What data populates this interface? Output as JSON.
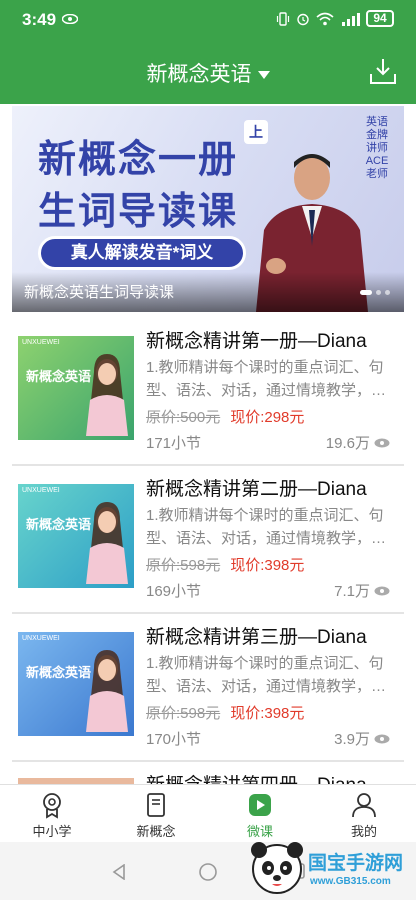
{
  "status_bar": {
    "time": "3:49",
    "battery": "94"
  },
  "header": {
    "title": "新概念英语"
  },
  "banner": {
    "headline_line1": "新概念一册",
    "headline_line2": "生词导读课",
    "badge": "上",
    "tag": "真人解读发音*词义",
    "side_text": "英语金牌讲师ACE老师",
    "caption": "新概念英语生词导读课"
  },
  "courses": [
    {
      "title": "新概念精讲第一册—Diana",
      "desc": "1.教师精讲每个课时的重点词汇、句型、语法、对话，通过情境教学，…",
      "price_original": "原价:500元",
      "price_current": "现价:298元",
      "lessons": "171小节",
      "views": "19.6万",
      "thumb_logo": "UNXUEWEI",
      "thumb_title": "新概念英语"
    },
    {
      "title": "新概念精讲第二册—Diana",
      "desc": "1.教师精讲每个课时的重点词汇、句型、语法、对话，通过情境教学，…",
      "price_original": "原价:598元",
      "price_current": "现价:398元",
      "lessons": "169小节",
      "views": "7.1万",
      "thumb_logo": "UNXUEWEI",
      "thumb_title": "新概念英语"
    },
    {
      "title": "新概念精讲第三册—Diana",
      "desc": "1.教师精讲每个课时的重点词汇、句型、语法、对话，通过情境教学，…",
      "price_original": "原价:598元",
      "price_current": "现价:398元",
      "lessons": "170小节",
      "views": "3.9万",
      "thumb_logo": "UNXUEWEI",
      "thumb_title": "新概念英语"
    },
    {
      "title": "新概念精讲第四册—Diana"
    }
  ],
  "tabs": [
    {
      "label": "中小学",
      "icon": "badge-icon"
    },
    {
      "label": "新概念",
      "icon": "book-icon"
    },
    {
      "label": "微课",
      "icon": "play-icon",
      "active": true
    },
    {
      "label": "我的",
      "icon": "person-icon"
    }
  ],
  "watermark": {
    "text": "国宝手游网",
    "url": "www.GB315.com"
  },
  "colors": {
    "primary": "#3ba34a",
    "price": "#e13b2b",
    "muted": "#888888"
  }
}
